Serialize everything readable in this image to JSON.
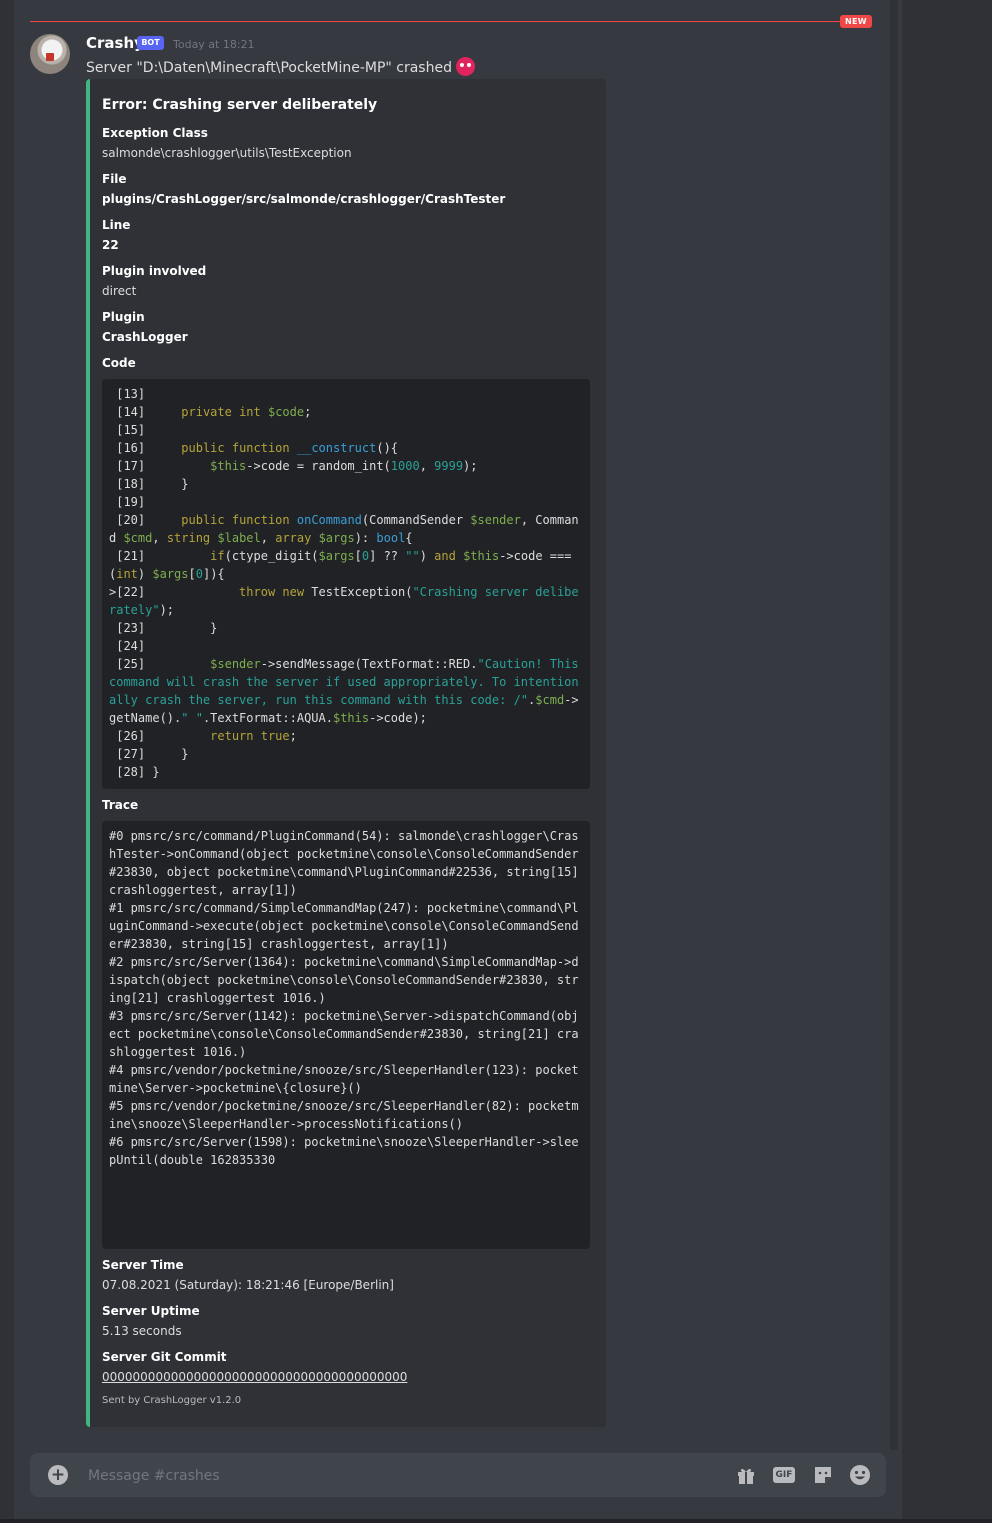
{
  "new_badge": "NEW",
  "message": {
    "author": "Crashy",
    "bot_tag": "BOT",
    "timestamp": "Today at 18:21",
    "text": "Server \"D:\\Daten\\Minecraft\\PocketMine-MP\" crashed"
  },
  "embed": {
    "accent_color": "#43b581",
    "title": "Error: Crashing server deliberately",
    "fields": {
      "exception_class": {
        "name": "Exception Class",
        "value": "salmonde\\crashlogger\\utils\\TestException"
      },
      "file": {
        "name": "File",
        "value": "plugins/CrashLogger/src/salmonde/crashlogger/CrashTester"
      },
      "line": {
        "name": "Line",
        "value": "22"
      },
      "plugin_involved": {
        "name": "Plugin involved",
        "value": "direct"
      },
      "plugin": {
        "name": "Plugin",
        "value": "CrashLogger"
      },
      "code": {
        "name": "Code"
      },
      "trace": {
        "name": "Trace"
      },
      "server_time": {
        "name": "Server Time",
        "value": "07.08.2021 (Saturday): 18:21:46 [Europe/Berlin]"
      },
      "server_uptime": {
        "name": "Server Uptime",
        "value": "5.13 seconds"
      },
      "git_commit": {
        "name": "Server Git Commit",
        "value": "0000000000000000000000000000000000000000"
      }
    },
    "code_lines": [
      [
        {
          "t": " [13]"
        }
      ],
      [
        {
          "t": " [14]     "
        },
        {
          "t": "private int",
          "c": "kw"
        },
        {
          "t": " "
        },
        {
          "t": "$code",
          "c": "var"
        },
        {
          "t": ";"
        }
      ],
      [
        {
          "t": " [15]"
        }
      ],
      [
        {
          "t": " [16]     "
        },
        {
          "t": "public function",
          "c": "kw"
        },
        {
          "t": " "
        },
        {
          "t": "__construct",
          "c": "fn"
        },
        {
          "t": "(){"
        }
      ],
      [
        {
          "t": " [17]         "
        },
        {
          "t": "$this",
          "c": "var"
        },
        {
          "t": "->code = random_int("
        },
        {
          "t": "1000",
          "c": "num"
        },
        {
          "t": ", "
        },
        {
          "t": "9999",
          "c": "num"
        },
        {
          "t": ");"
        }
      ],
      [
        {
          "t": " [18]     }"
        }
      ],
      [
        {
          "t": " [19]"
        }
      ],
      [
        {
          "t": " [20]     "
        },
        {
          "t": "public function",
          "c": "kw"
        },
        {
          "t": " "
        },
        {
          "t": "onCommand",
          "c": "fn"
        },
        {
          "t": "(CommandSender "
        },
        {
          "t": "$sender",
          "c": "var"
        },
        {
          "t": ", Command "
        },
        {
          "t": "$cmd",
          "c": "var"
        },
        {
          "t": ", "
        },
        {
          "t": "string",
          "c": "kw"
        },
        {
          "t": " "
        },
        {
          "t": "$label",
          "c": "var"
        },
        {
          "t": ", "
        },
        {
          "t": "array",
          "c": "kw"
        },
        {
          "t": " "
        },
        {
          "t": "$args",
          "c": "var"
        },
        {
          "t": "): "
        },
        {
          "t": "bool",
          "c": "fn"
        },
        {
          "t": "{"
        }
      ],
      [
        {
          "t": " [21]         "
        },
        {
          "t": "if",
          "c": "kw"
        },
        {
          "t": "(ctype_digit("
        },
        {
          "t": "$args",
          "c": "var"
        },
        {
          "t": "["
        },
        {
          "t": "0",
          "c": "num"
        },
        {
          "t": "] ?? "
        },
        {
          "t": "\"\"",
          "c": "str"
        },
        {
          "t": ") "
        },
        {
          "t": "and",
          "c": "kw"
        },
        {
          "t": " "
        },
        {
          "t": "$this",
          "c": "var"
        },
        {
          "t": "->code === ("
        },
        {
          "t": "int",
          "c": "kw"
        },
        {
          "t": ") "
        },
        {
          "t": "$args",
          "c": "var"
        },
        {
          "t": "["
        },
        {
          "t": "0",
          "c": "num"
        },
        {
          "t": "]){"
        }
      ],
      [
        {
          "t": ">[22]             "
        },
        {
          "t": "throw new",
          "c": "kw"
        },
        {
          "t": " TestException("
        },
        {
          "t": "\"Crashing server deliberately\"",
          "c": "str"
        },
        {
          "t": ");"
        }
      ],
      [
        {
          "t": " [23]         }"
        }
      ],
      [
        {
          "t": " [24]"
        }
      ],
      [
        {
          "t": " [25]         "
        },
        {
          "t": "$sender",
          "c": "var"
        },
        {
          "t": "->sendMessage(TextFormat::RED."
        },
        {
          "t": "\"Caution! This command will crash the server if used appropriately. To intentionally crash the server, run this command with this code: /\"",
          "c": "str"
        },
        {
          "t": "."
        },
        {
          "t": "$cmd",
          "c": "var"
        },
        {
          "t": "->getName()."
        },
        {
          "t": "\" \"",
          "c": "str"
        },
        {
          "t": ".TextFormat::AQUA."
        },
        {
          "t": "$this",
          "c": "var"
        },
        {
          "t": "->code);"
        }
      ],
      [
        {
          "t": " [26]         "
        },
        {
          "t": "return true",
          "c": "kw"
        },
        {
          "t": ";"
        }
      ],
      [
        {
          "t": " [27]     }"
        }
      ],
      [
        {
          "t": " [28] }"
        }
      ]
    ],
    "trace": "#0 pmsrc/src/command/PluginCommand(54): salmonde\\crashlogger\\CrashTester->onCommand(object pocketmine\\console\\ConsoleCommandSender#23830, object pocketmine\\command\\PluginCommand#22536, string[15] crashloggertest, array[1])\n#1 pmsrc/src/command/SimpleCommandMap(247): pocketmine\\command\\PluginCommand->execute(object pocketmine\\console\\ConsoleCommandSender#23830, string[15] crashloggertest, array[1])\n#2 pmsrc/src/Server(1364): pocketmine\\command\\SimpleCommandMap->dispatch(object pocketmine\\console\\ConsoleCommandSender#23830, string[21] crashloggertest 1016.)\n#3 pmsrc/src/Server(1142): pocketmine\\Server->dispatchCommand(object pocketmine\\console\\ConsoleCommandSender#23830, string[21] crashloggertest 1016.)\n#4 pmsrc/vendor/pocketmine/snooze/src/SleeperHandler(123): pocketmine\\Server->pocketmine\\{closure}()\n#5 pmsrc/vendor/pocketmine/snooze/src/SleeperHandler(82): pocketmine\\snooze\\SleeperHandler->processNotifications()\n#6 pmsrc/src/Server(1598): pocketmine\\snooze\\SleeperHandler->sleepUntil(double 162835330",
    "footer": "Sent by CrashLogger v1.2.0"
  },
  "composer": {
    "placeholder": "Message #crashes",
    "gif_label": "GIF",
    "icons": [
      "plus-circle-icon",
      "gift-icon",
      "gif-icon",
      "sticker-icon",
      "emoji-icon"
    ]
  }
}
